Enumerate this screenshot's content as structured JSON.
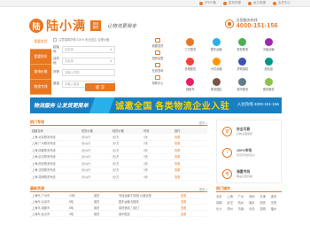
{
  "topbar": {
    "links": [
      "沪ICP备",
      "发布货源",
      "运力资源",
      "会员中心"
    ]
  },
  "header": {
    "logo_mark": "陆",
    "logo_text": "陆小满",
    "logo_badge": [
      "物流",
      "服务"
    ],
    "slogan": "让物流更简单",
    "hotline_label": "全国服务热线",
    "hotline_number": "4000-151-156"
  },
  "tabs": [
    "我要发货",
    "我要找车",
    "查询价格",
    "物流专线"
  ],
  "form": {
    "tip": "注意保障货物 100% 安全送达 合理价格",
    "rows": [
      {
        "label": "起始地",
        "placeholder": "请选择"
      },
      {
        "label": "目的地",
        "placeholder": "请选择"
      },
      {
        "label": "货物",
        "placeholder": "请输入货物"
      },
      {
        "label": "重量",
        "placeholder": "请输入重量"
      }
    ],
    "submit": "提 交"
  },
  "side_box": [
    "我要发货",
    "招商加盟",
    "在线咨询",
    "帮助中心"
  ],
  "service_grid": [
    {
      "label": "三方物流",
      "color": "#e87722"
    },
    {
      "label": "整车运输",
      "color": "#2ab0e8"
    },
    {
      "label": "零担物流",
      "color": "#4caf50"
    },
    {
      "label": "冷链运输",
      "color": "#9c27b0"
    },
    {
      "label": "仓储配送",
      "color": "#f44336"
    },
    {
      "label": "大件运输",
      "color": "#ff9800"
    },
    {
      "label": "货物保险",
      "color": "#3f51b5"
    },
    {
      "label": "危险品",
      "color": "#009688"
    },
    {
      "label": "回程车",
      "color": "#e91e63"
    },
    {
      "label": "物流园区",
      "color": "#795548"
    },
    {
      "label": "城市配送",
      "color": "#607d8b"
    },
    {
      "label": "更多服务",
      "color": "#8bc34a"
    }
  ],
  "banner": {
    "left": "物流服务 让发货更简单",
    "center": "诚邀全国 各类物流企业入驻",
    "right": "入驻热线 4000-151-156"
  },
  "price_section": {
    "title": "热门专线",
    "more": "更多 >",
    "headers": [
      "线路名称",
      "重货价格",
      "轻货价格",
      "时效",
      "操作"
    ],
    "rows": [
      [
        "上海-北京物流专线",
        "元/公斤",
        "元/方",
        "2天",
        "查看"
      ],
      [
        "上海-广州物流专线",
        "元/公斤",
        "元/方",
        "2天",
        "查看"
      ],
      [
        "上海-成都物流专线",
        "元/公斤",
        "元/方",
        "3天",
        "查看"
      ],
      [
        "上海-武汉物流专线",
        "元/公斤",
        "元/方",
        "2天",
        "查看"
      ],
      [
        "上海-西安物流专线",
        "元/公斤",
        "元/方",
        "3天",
        "查看"
      ],
      [
        "上海-沈阳物流专线",
        "元/公斤",
        "元/方",
        "3天",
        "查看"
      ],
      [
        "上海-昆明物流专线",
        "元/公斤",
        "元/方",
        "4天",
        "查看"
      ]
    ]
  },
  "features": [
    {
      "icon": "安",
      "title": "安全可靠",
      "sub": "货物全程保险"
    },
    {
      "icon": "√",
      "title": "100%市场",
      "sub": "真实有效的运力"
    },
    {
      "icon": "专",
      "title": "海量专线",
      "sub": "覆盖全国线路"
    }
  ],
  "bottom": {
    "title": "最新货源",
    "more": "更多 >",
    "city_title": "热门城市",
    "rows": [
      [
        "上海市-广州市",
        "10吨",
        "普货",
        "专线运输 时效快 价格优惠",
        "查看"
      ],
      [
        "上海市-北京市",
        "5吨",
        "普货",
        "整车运输 回程车",
        "查看"
      ],
      [
        "上海市-成都市",
        "8吨",
        "普货",
        "零担物流 门到门",
        "查看"
      ],
      [
        "上海市-武汉市",
        "3吨",
        "普货",
        "城市配送",
        "查看"
      ]
    ],
    "cities": [
      "北京",
      "上海",
      "广州",
      "深圳",
      "天津",
      "重庆",
      "成都",
      "武汉",
      "杭州",
      "南京",
      "西安",
      "沈阳",
      "长沙",
      "郑州",
      "济南",
      "青岛",
      "昆明",
      "福州"
    ]
  }
}
